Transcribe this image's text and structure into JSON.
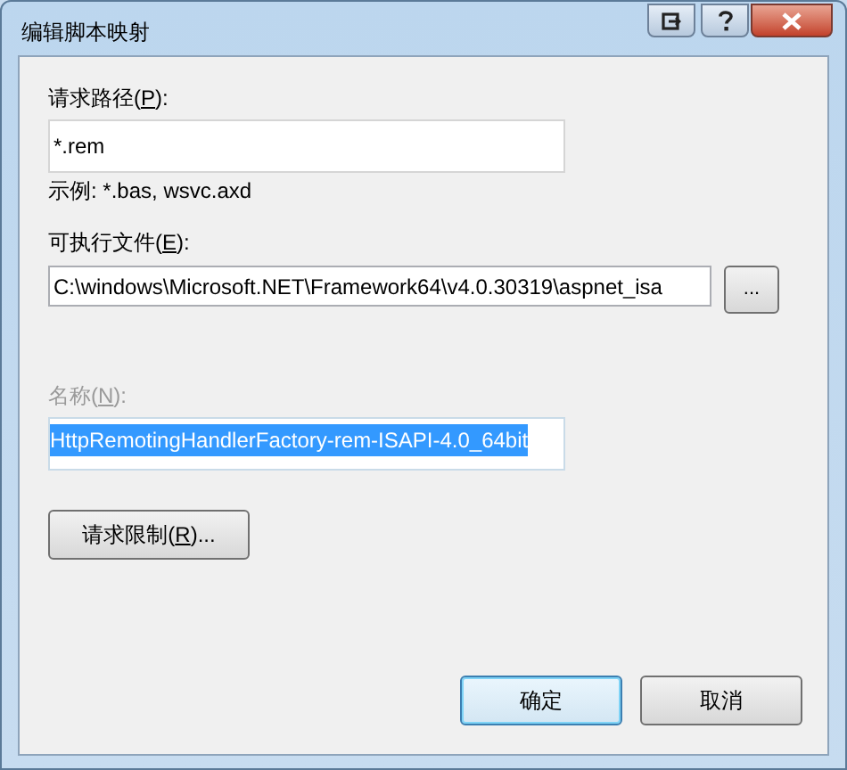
{
  "window": {
    "title": "编辑脚本映射"
  },
  "title_buttons": [
    {
      "kind": "restore"
    },
    {
      "kind": "help"
    },
    {
      "kind": "close"
    }
  ],
  "request_path": {
    "label_parts": [
      "请求路径(",
      "P",
      "):"
    ],
    "value": "*.rem",
    "hint": "示例: *.bas, wsvc.axd"
  },
  "executable": {
    "label_parts": [
      "可执行文件(",
      "E",
      "):"
    ],
    "value": "C:\\windows\\Microsoft.NET\\Framework64\\v4.0.30319\\aspnet_isa",
    "browse_button": "..."
  },
  "name": {
    "label_parts": [
      "名称(",
      "N",
      "):"
    ],
    "disabled": true,
    "value": "HttpRemotingHandlerFactory-rem-ISAPI-4.0_64bit",
    "selected": true
  },
  "restrictions_button": {
    "label_parts": [
      "请求限制(",
      "R",
      ")..."
    ]
  },
  "buttons": [
    {
      "label": "确定",
      "default": true
    },
    {
      "label": "取消",
      "default": false
    }
  ]
}
